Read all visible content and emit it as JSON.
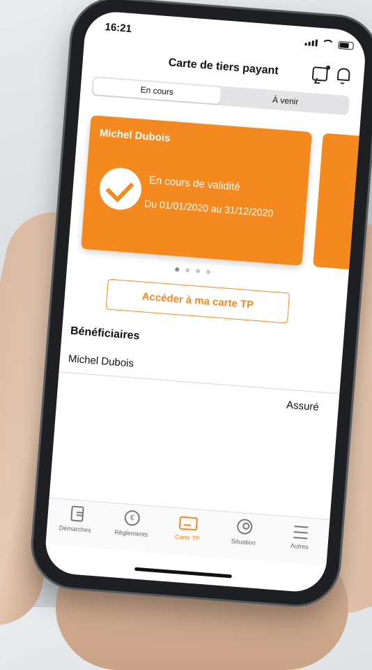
{
  "status_bar": {
    "time": "16:21"
  },
  "header": {
    "title": "Carte de tiers payant"
  },
  "segments": [
    {
      "label": "En cours",
      "active": true
    },
    {
      "label": "À venir",
      "active": false
    }
  ],
  "card": {
    "holder_name": "Michel Dubois",
    "status": "En cours de validité",
    "dates": "Du 01/01/2020 au 31/12/2020",
    "color": "#f48a1f"
  },
  "pager": {
    "count": 4,
    "active_index": 0
  },
  "cta": {
    "label": "Accéder à ma carte TP"
  },
  "beneficiaries": {
    "title": "Bénéficiaires",
    "items": [
      {
        "name": "Michel Dubois",
        "role": "Assuré"
      }
    ]
  },
  "tabbar": {
    "items": [
      {
        "label": "Démarches",
        "icon": "document-icon"
      },
      {
        "label": "Règlements",
        "icon": "euro-refresh-icon"
      },
      {
        "label": "Carte TP",
        "icon": "card-icon",
        "active": true
      },
      {
        "label": "Situation",
        "icon": "user-icon"
      },
      {
        "label": "Autres",
        "icon": "menu-icon"
      }
    ]
  }
}
